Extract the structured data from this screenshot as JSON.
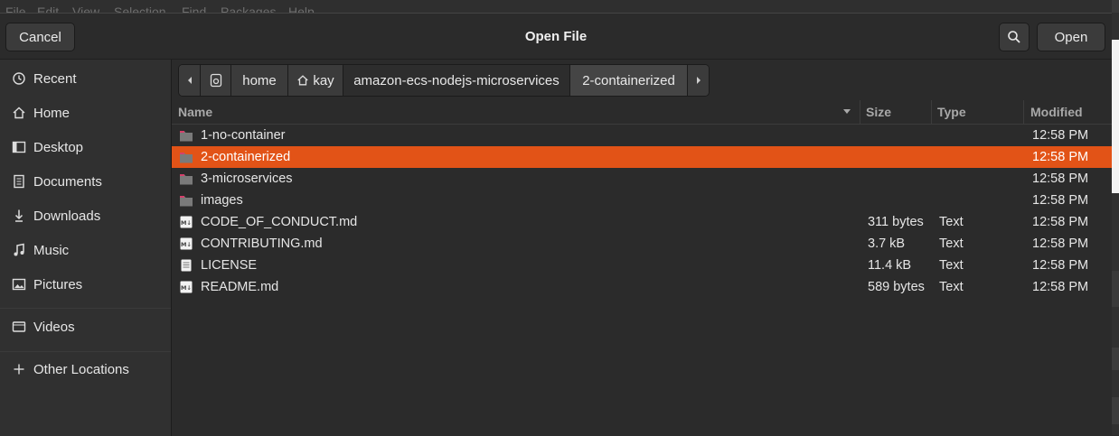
{
  "background": {
    "menu": [
      "File",
      "Edit",
      "View",
      "Selection",
      "Find",
      "Packages",
      "Help"
    ]
  },
  "dialog": {
    "title": "Open File",
    "cancel_label": "Cancel",
    "open_label": "Open"
  },
  "sidebar": {
    "items": [
      {
        "label": "Recent",
        "icon": "clock-icon"
      },
      {
        "label": "Home",
        "icon": "home-icon"
      },
      {
        "label": "Desktop",
        "icon": "desktop-icon"
      },
      {
        "label": "Documents",
        "icon": "document-icon"
      },
      {
        "label": "Downloads",
        "icon": "download-icon"
      },
      {
        "label": "Music",
        "icon": "music-icon"
      },
      {
        "label": "Pictures",
        "icon": "picture-icon"
      },
      {
        "label": "Videos",
        "icon": "video-icon"
      },
      {
        "label": "Other Locations",
        "icon": "plus-icon"
      }
    ]
  },
  "pathbar": {
    "crumbs": [
      "home",
      "kay",
      "amazon-ecs-nodejs-microservices",
      "2-containerized"
    ]
  },
  "columns": {
    "name": "Name",
    "size": "Size",
    "type": "Type",
    "modified": "Modified"
  },
  "files": [
    {
      "name": "1-no-container",
      "size": "",
      "type": "",
      "modified": "12:58 PM",
      "kind": "folder"
    },
    {
      "name": "2-containerized",
      "size": "",
      "type": "",
      "modified": "12:58 PM",
      "kind": "folder",
      "selected": true
    },
    {
      "name": "3-microservices",
      "size": "",
      "type": "",
      "modified": "12:58 PM",
      "kind": "folder"
    },
    {
      "name": "images",
      "size": "",
      "type": "",
      "modified": "12:58 PM",
      "kind": "folder"
    },
    {
      "name": "CODE_OF_CONDUCT.md",
      "size": "311 bytes",
      "type": "Text",
      "modified": "12:58 PM",
      "kind": "markdown"
    },
    {
      "name": "CONTRIBUTING.md",
      "size": "3.7 kB",
      "type": "Text",
      "modified": "12:58 PM",
      "kind": "markdown"
    },
    {
      "name": "LICENSE",
      "size": "11.4 kB",
      "type": "Text",
      "modified": "12:58 PM",
      "kind": "text"
    },
    {
      "name": "README.md",
      "size": "589 bytes",
      "type": "Text",
      "modified": "12:58 PM",
      "kind": "markdown"
    }
  ],
  "colors": {
    "selection": "#e25317",
    "folder": "#7a7a7a",
    "folder_tab": "#d6406b"
  }
}
